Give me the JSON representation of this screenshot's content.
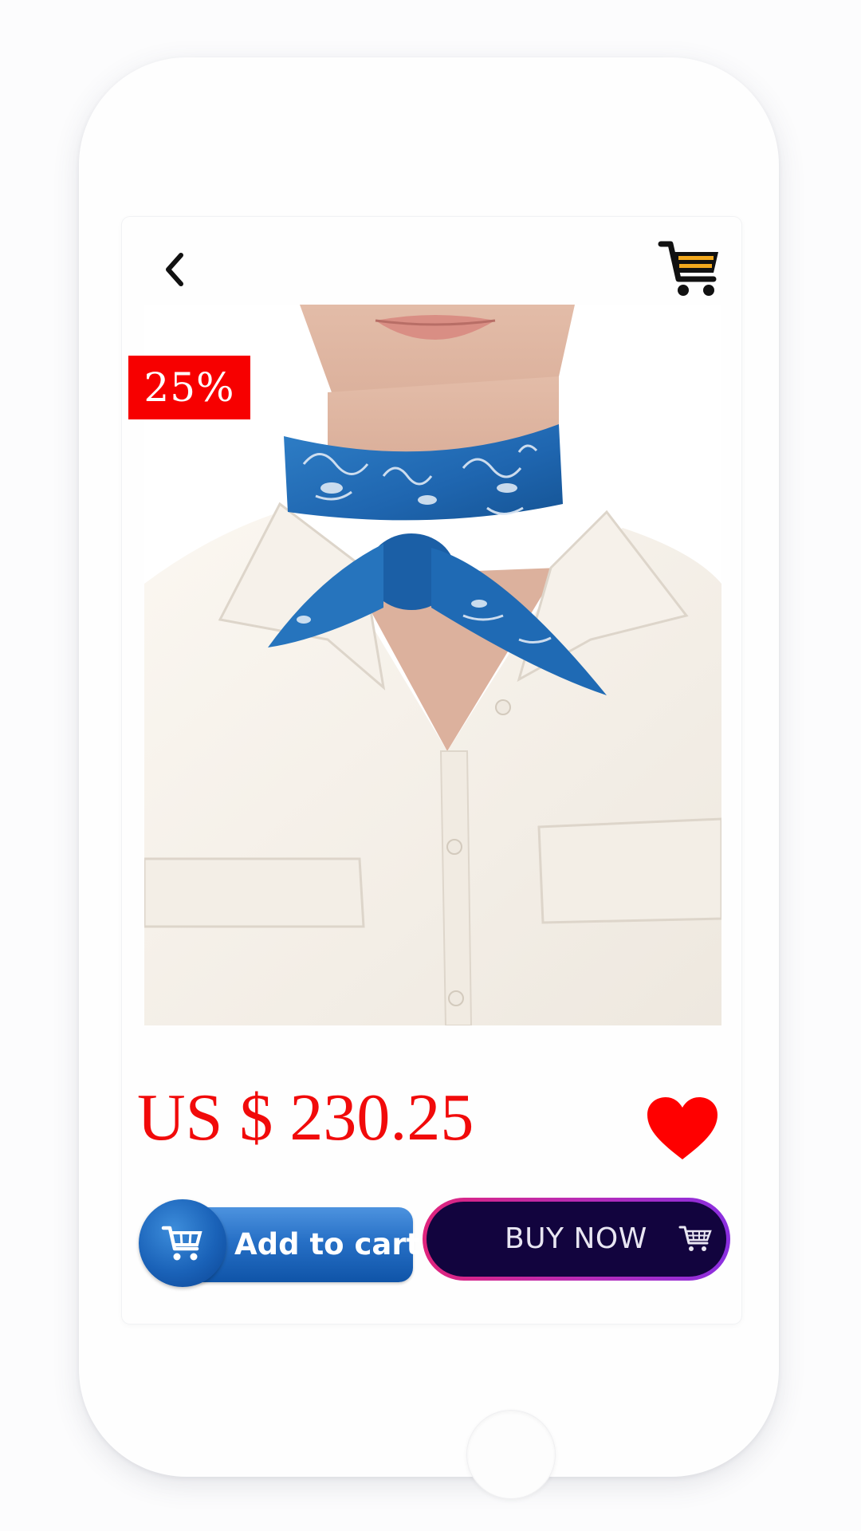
{
  "product": {
    "discount_badge": "25%",
    "price": "US $ 230.25",
    "image": "woman wearing a blue patterned silk scarf tied at the neck over a white button-up shirt"
  },
  "actions": {
    "add_to_cart_label": "Add to cart",
    "buy_now_label": "BUY NOW"
  },
  "icons": {
    "back": "chevron-left-icon",
    "cart": "shopping-cart-icon",
    "favorite": "heart-icon",
    "add_to_cart": "cart-icon",
    "buy_now": "cart-icon"
  },
  "colors": {
    "badge_background": "#f70000",
    "price_text": "#f10a0a",
    "heart": "#ff0000",
    "add_to_cart_button": "#1f64bb",
    "buy_now_background": "#12043e",
    "buy_now_border_start": "#e0247c",
    "buy_now_border_end": "#8a2fe0",
    "cart_accent": "#f2a81d"
  }
}
